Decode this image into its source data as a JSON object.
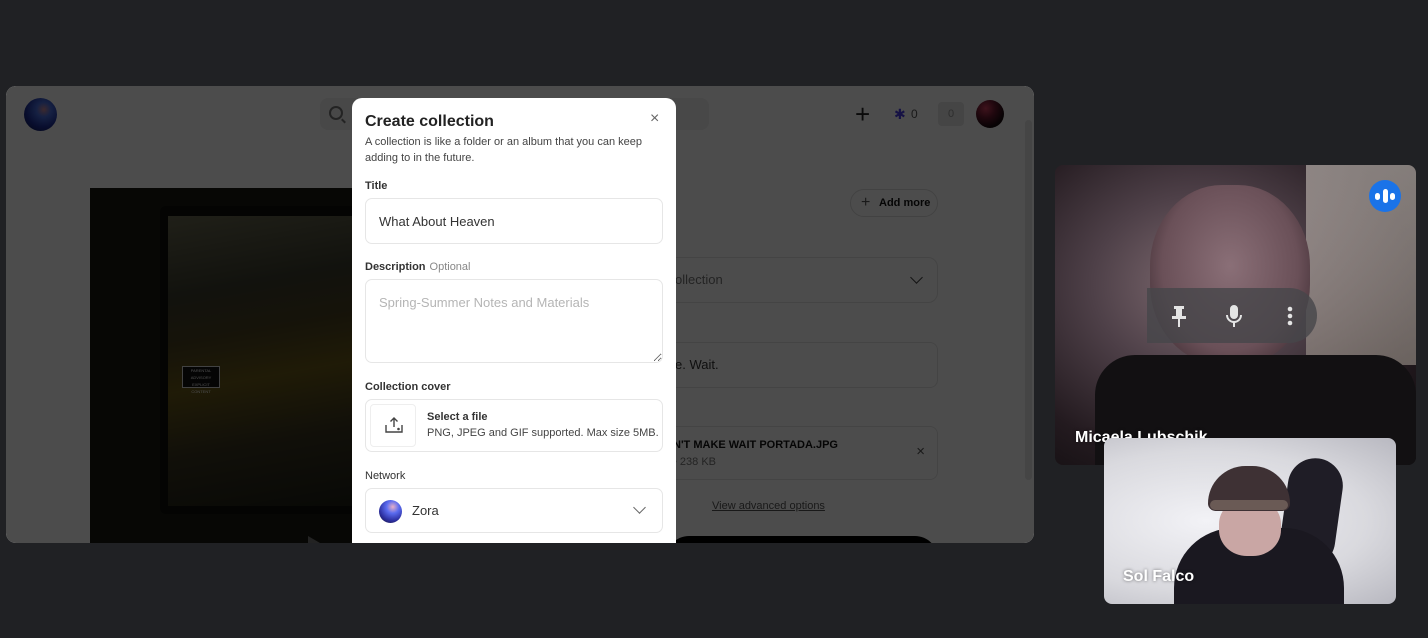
{
  "shared_page": {
    "topbar": {
      "logo_icon": "zora-orb-logo",
      "search_icon": "search-icon",
      "create_icon": "plus-icon",
      "zorb_icon": "asterisk-icon",
      "zorb_count": "0",
      "notifications_count": "0",
      "avatar": "user-avatar"
    },
    "artwork": {
      "advisory_label": "PARENTAL ADVISORY EXPLICIT CONTENT"
    },
    "form": {
      "add_more_label": "Add more",
      "collection_select_text": "ollection",
      "name_value": "e. Wait.",
      "file_name": "N'T MAKE WAIT PORTADA.JPG",
      "file_size": "• 238 KB",
      "advanced_link": "View advanced options"
    }
  },
  "modal": {
    "title": "Create collection",
    "close_glyph": "×",
    "subtitle": "A collection is like a folder or an album that you can keep adding to in the future.",
    "title_label": "Title",
    "title_value": "What About Heaven",
    "description_label": "Description",
    "description_optional": "Optional",
    "description_placeholder": "Spring-Summer Notes and Materials",
    "cover_label": "Collection cover",
    "cover_title": "Select a file",
    "cover_hint": "PNG, JPEG and GIF supported. Max size 5MB.",
    "network_label": "Network",
    "network_value": "Zora"
  },
  "call": {
    "participants": [
      {
        "name": "Micaela Lubschik",
        "speaking": true
      },
      {
        "name": "Sol Falco",
        "speaking": false
      }
    ],
    "hover_controls": {
      "pin_glyph": "⊥",
      "mic_glyph": "🎙",
      "more_glyph": "⋮"
    },
    "speaking_color": "#1a73e8"
  }
}
